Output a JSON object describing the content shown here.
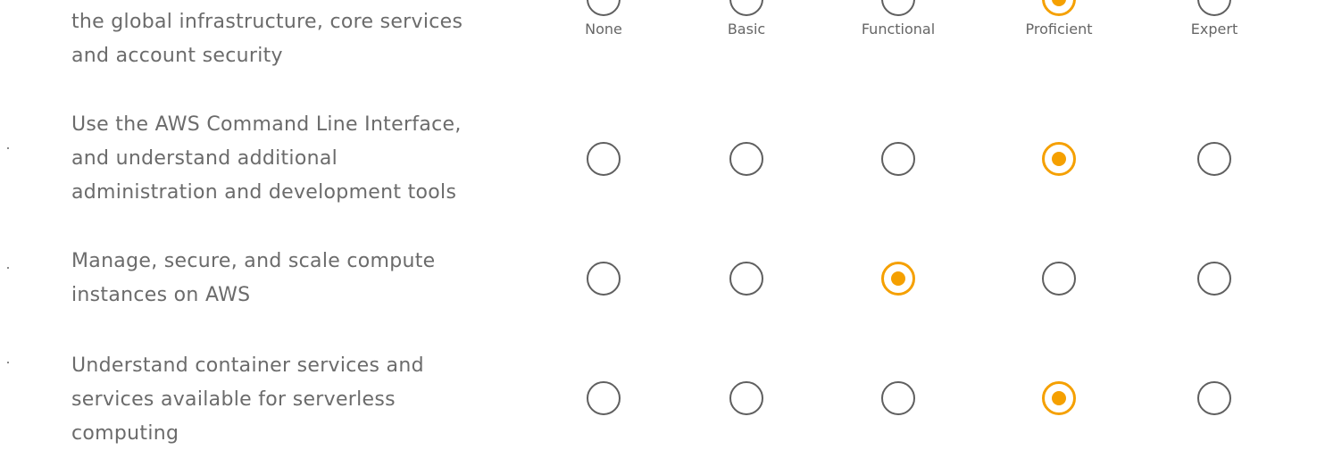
{
  "scale": {
    "levels": [
      "None",
      "Basic",
      "Functional",
      "Proficient",
      "Expert"
    ]
  },
  "rows": [
    {
      "lines": [
        "the global infrastructure, core services",
        "and account security"
      ],
      "selected": 3
    },
    {
      "lines": [
        "Use the AWS Command Line Interface,",
        "and understand additional",
        "administration and development tools"
      ],
      "selected": 3
    },
    {
      "lines": [
        "Manage, secure, and scale compute",
        "instances on AWS"
      ],
      "selected": 2
    },
    {
      "lines": [
        "Understand container services and",
        "services available for serverless",
        "computing"
      ],
      "selected": 3
    }
  ],
  "colors": {
    "accent": "#f5a000",
    "radio_border": "#5f5f5f",
    "text": "#6b6b6b"
  }
}
